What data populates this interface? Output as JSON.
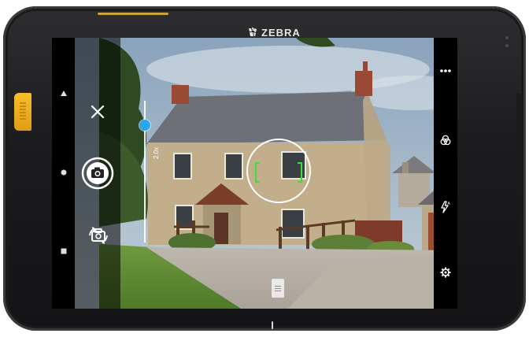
{
  "device": {
    "brand_text": "ZEBRA",
    "brand_icon": "zebra-head-icon",
    "accent_button_color": "#f0b020"
  },
  "navigation_bar": {
    "back_icon": "triangle-back-icon",
    "home_icon": "circle-home-icon",
    "recents_icon": "square-recents-icon"
  },
  "camera": {
    "close_icon": "close-icon",
    "shutter_icon": "camera-shutter-icon",
    "switch_camera_icon": "switch-camera-icon",
    "more_options_icon": "more-options-icon",
    "filters_icon": "color-filter-icon",
    "flash_icon": "flash-auto-icon",
    "settings_icon": "settings-gear-icon",
    "zoom_label": "2.0x",
    "zoom_level": 0.13,
    "accent_color": "#2aa7f0",
    "focus_color": "#3fdc3f"
  }
}
